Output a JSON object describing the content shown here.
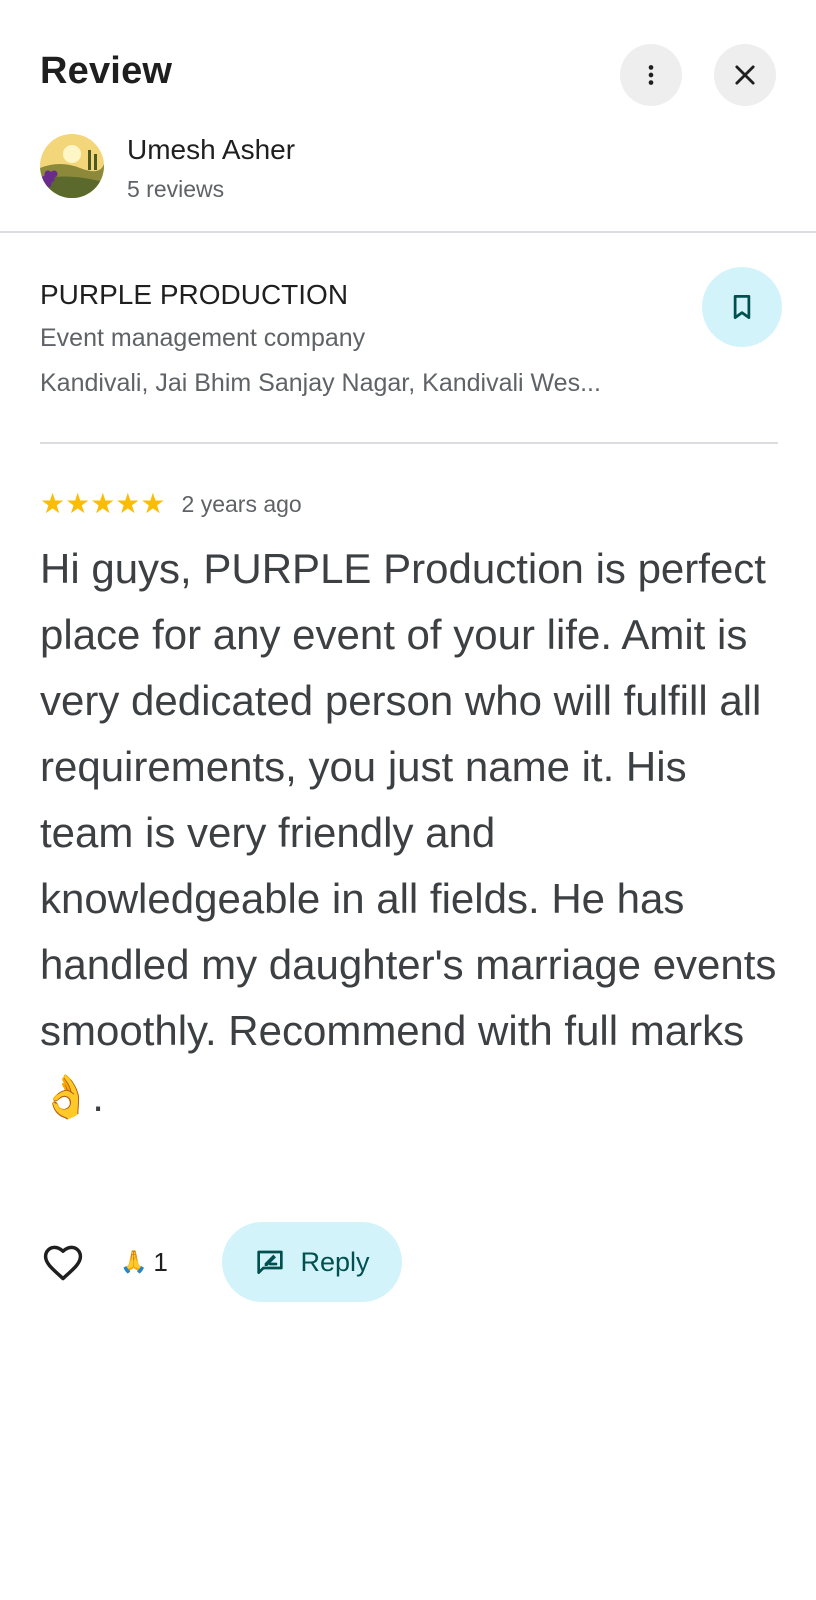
{
  "header": {
    "title": "Review"
  },
  "author": {
    "name": "Umesh Asher",
    "reviews": "5 reviews"
  },
  "place": {
    "name": "PURPLE PRODUCTION",
    "type": "Event management company",
    "address": "Kandivali, Jai Bhim Sanjay Nagar, Kandivali Wes..."
  },
  "review": {
    "rating": 5,
    "stars": "★★★★★",
    "time": "2 years ago",
    "text": "Hi guys, PURPLE Production is perfect place for any event of your life. Amit is very dedicated person who will fulfill all requirements, you just name it. His team is very friendly and knowledgeable in all fields. He has handled my daughter's marriage events smoothly. Recommend with full marks 👌."
  },
  "actions": {
    "reaction_emoji": "🙏",
    "reaction_count": "1",
    "reply_label": "Reply"
  },
  "colors": {
    "accent_bg": "#d3f3fb",
    "accent_fg": "#00504f",
    "star": "#fbbc04"
  },
  "icons": {
    "more": "more-vert-icon",
    "close": "close-icon",
    "save": "bookmark-icon",
    "like": "heart-icon",
    "reply": "reply-icon"
  }
}
